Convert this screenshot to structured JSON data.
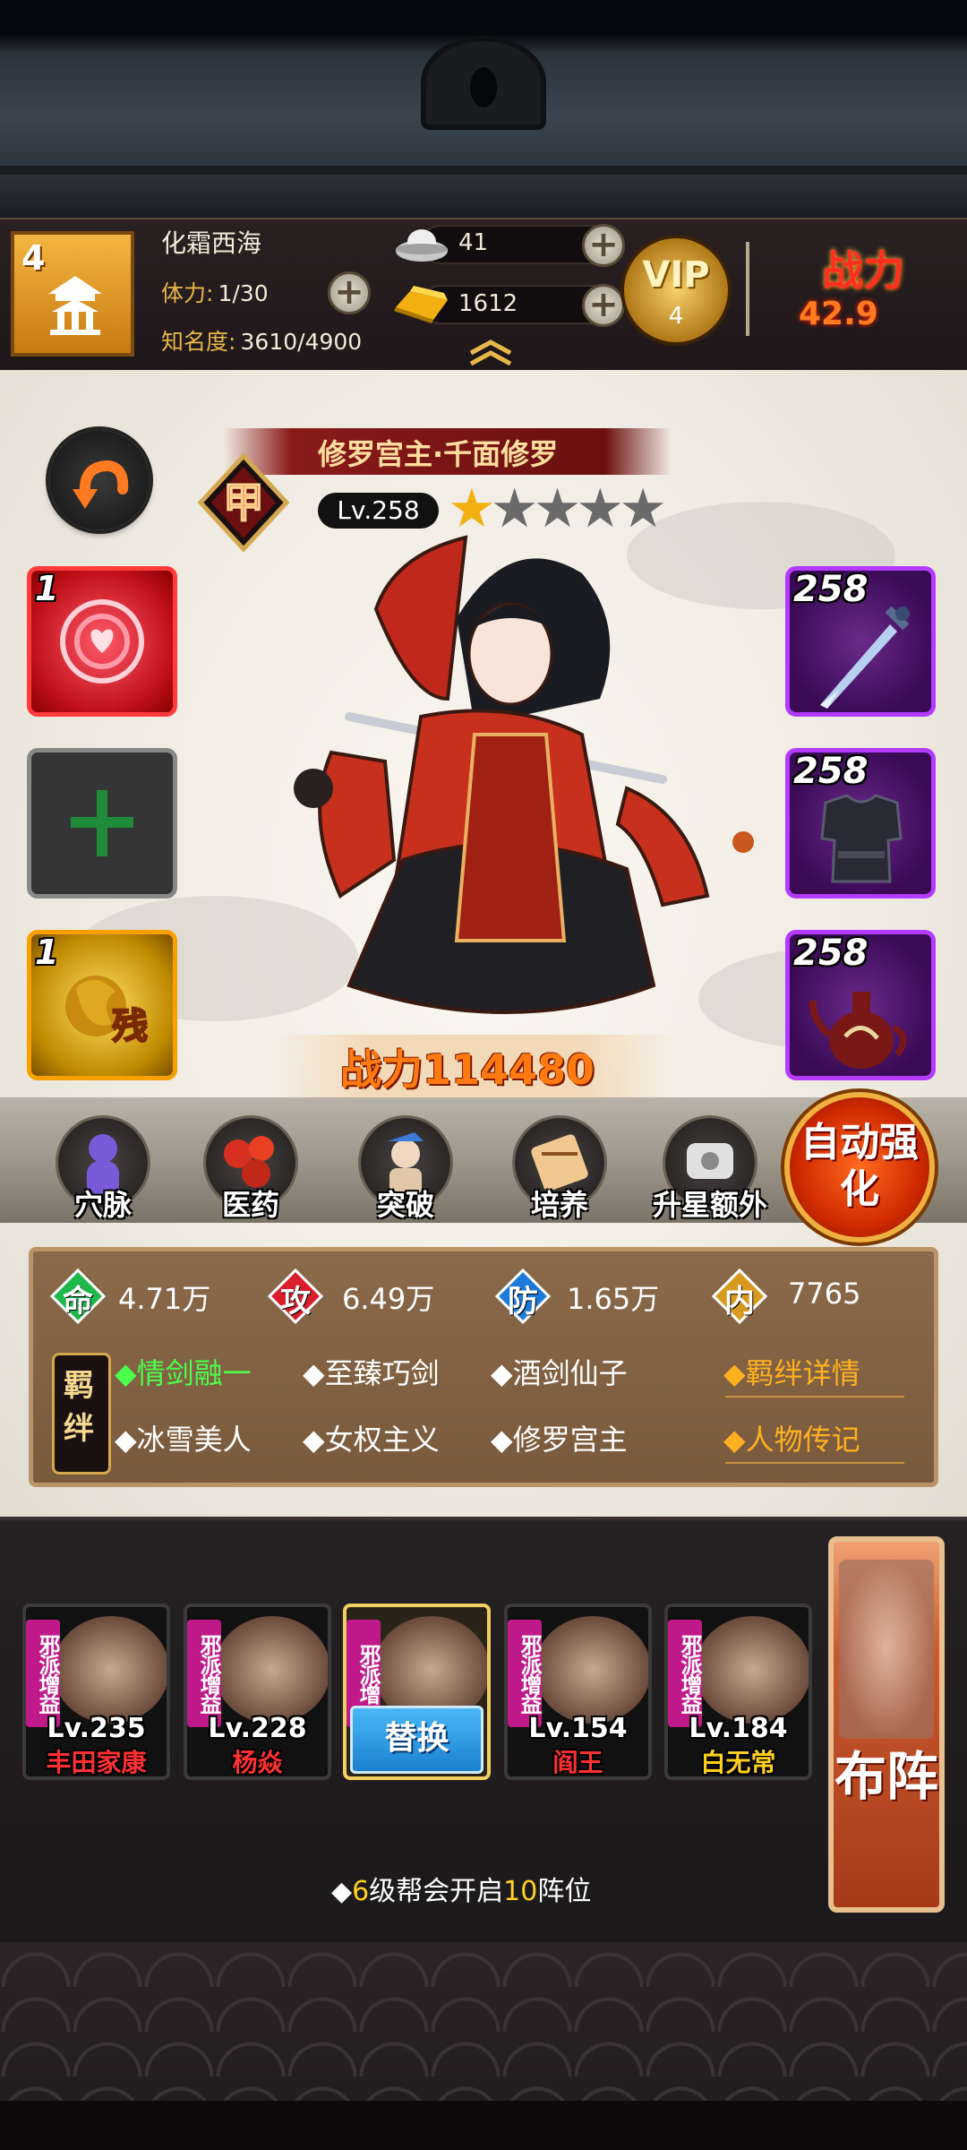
{
  "player": {
    "guild_level": "4",
    "name": "化霜西海",
    "stamina_label": "体力:",
    "stamina_value": "1/30",
    "fame_label": "知名度:",
    "fame_value": "3610/4900",
    "silver": "41",
    "gold": "1612",
    "vip_label": "VIP",
    "vip_level": "4",
    "power_label": "战力",
    "power_value": "42.9"
  },
  "hero": {
    "title": "修罗宫主·千面修罗",
    "rank_char": "甲",
    "level": "Lv.258",
    "stars_total": 5,
    "stars_filled": 1,
    "power": "战力114480"
  },
  "slots": {
    "left": [
      {
        "count": "1",
        "icon": "red-swirl-skill-icon"
      },
      {
        "count": "",
        "icon": "plus-icon",
        "symbol": "十"
      },
      {
        "count": "1",
        "icon": "golden-fragment-icon",
        "symbol": "残"
      }
    ],
    "right": [
      {
        "count": "258",
        "icon": "sword-icon"
      },
      {
        "count": "258",
        "icon": "armor-icon"
      },
      {
        "count": "258",
        "icon": "teapot-icon"
      }
    ]
  },
  "actions": [
    {
      "label": "穴脉",
      "icon": "meridian-icon"
    },
    {
      "label": "医药",
      "icon": "medicine-icon"
    },
    {
      "label": "突破",
      "icon": "breakthrough-icon"
    },
    {
      "label": "培养",
      "icon": "cultivate-icon"
    },
    {
      "label": "升星额外",
      "icon": "star-upgrade-icon"
    }
  ],
  "auto_strengthen": "自动强化",
  "attributes": [
    {
      "char": "命",
      "value": "4.71万",
      "color": "#1eb84a"
    },
    {
      "char": "攻",
      "value": "6.49万",
      "color": "#d81e2a"
    },
    {
      "char": "防",
      "value": "1.65万",
      "color": "#1e7ad8"
    },
    {
      "char": "内",
      "value": "7765",
      "color": "#d89a1e"
    }
  ],
  "bonds": {
    "seal": "羁绊",
    "items": [
      "◆情剑融一",
      "◆至臻巧剑",
      "◆酒剑仙子",
      "◆冰雪美人",
      "◆女权主义",
      "◆修罗宫主"
    ],
    "active_index": 0,
    "detail_link": "◆羁绊详情",
    "bio_link": "◆人物传记"
  },
  "team": [
    {
      "faction": "邪派增益",
      "level": "Lv.235",
      "name": "丰田家康",
      "name_color": "#ff3030"
    },
    {
      "faction": "邪派增益",
      "level": "Lv.228",
      "name": "杨焱",
      "name_color": "#ff3030"
    },
    {
      "faction": "邪派增",
      "level": "",
      "name": "",
      "name_color": "#ffffff",
      "selected": true,
      "button": "替换"
    },
    {
      "faction": "邪派增益",
      "level": "Lv.154",
      "name": "阎王",
      "name_color": "#ff3030"
    },
    {
      "faction": "邪派增益",
      "level": "Lv.184",
      "name": "白无常",
      "name_color": "#ffd020"
    }
  ],
  "formation": "布阵",
  "unlock_hint": {
    "prefix": "◆",
    "num1": "6",
    "mid": "级帮会开启",
    "num2": "10",
    "suffix": "阵位"
  }
}
